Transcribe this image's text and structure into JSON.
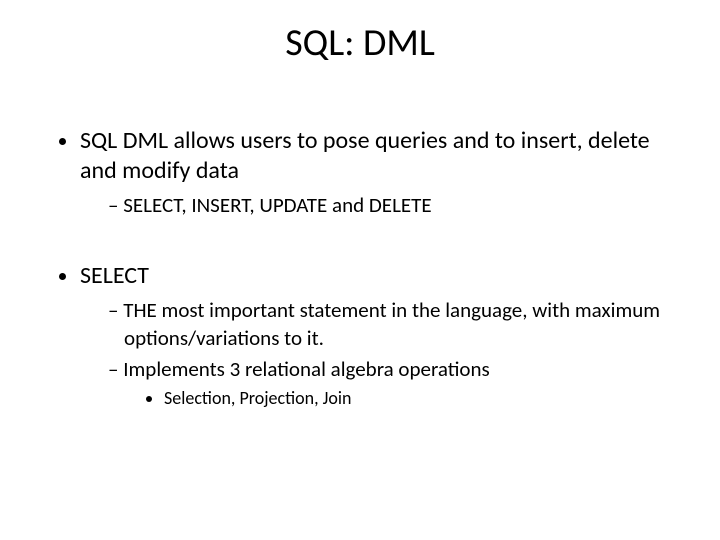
{
  "title": "SQL: DML",
  "bullets": {
    "item1": "SQL DML allows users to pose queries and to insert, delete and modify data",
    "item1_sub1": "SELECT, INSERT, UPDATE and DELETE",
    "item2": "SELECT",
    "item2_sub1": "THE most important statement in the language, with maximum options/variations to it.",
    "item2_sub2": "Implements 3 relational algebra operations",
    "item2_sub2_sub1": "Selection, Projection, Join"
  }
}
